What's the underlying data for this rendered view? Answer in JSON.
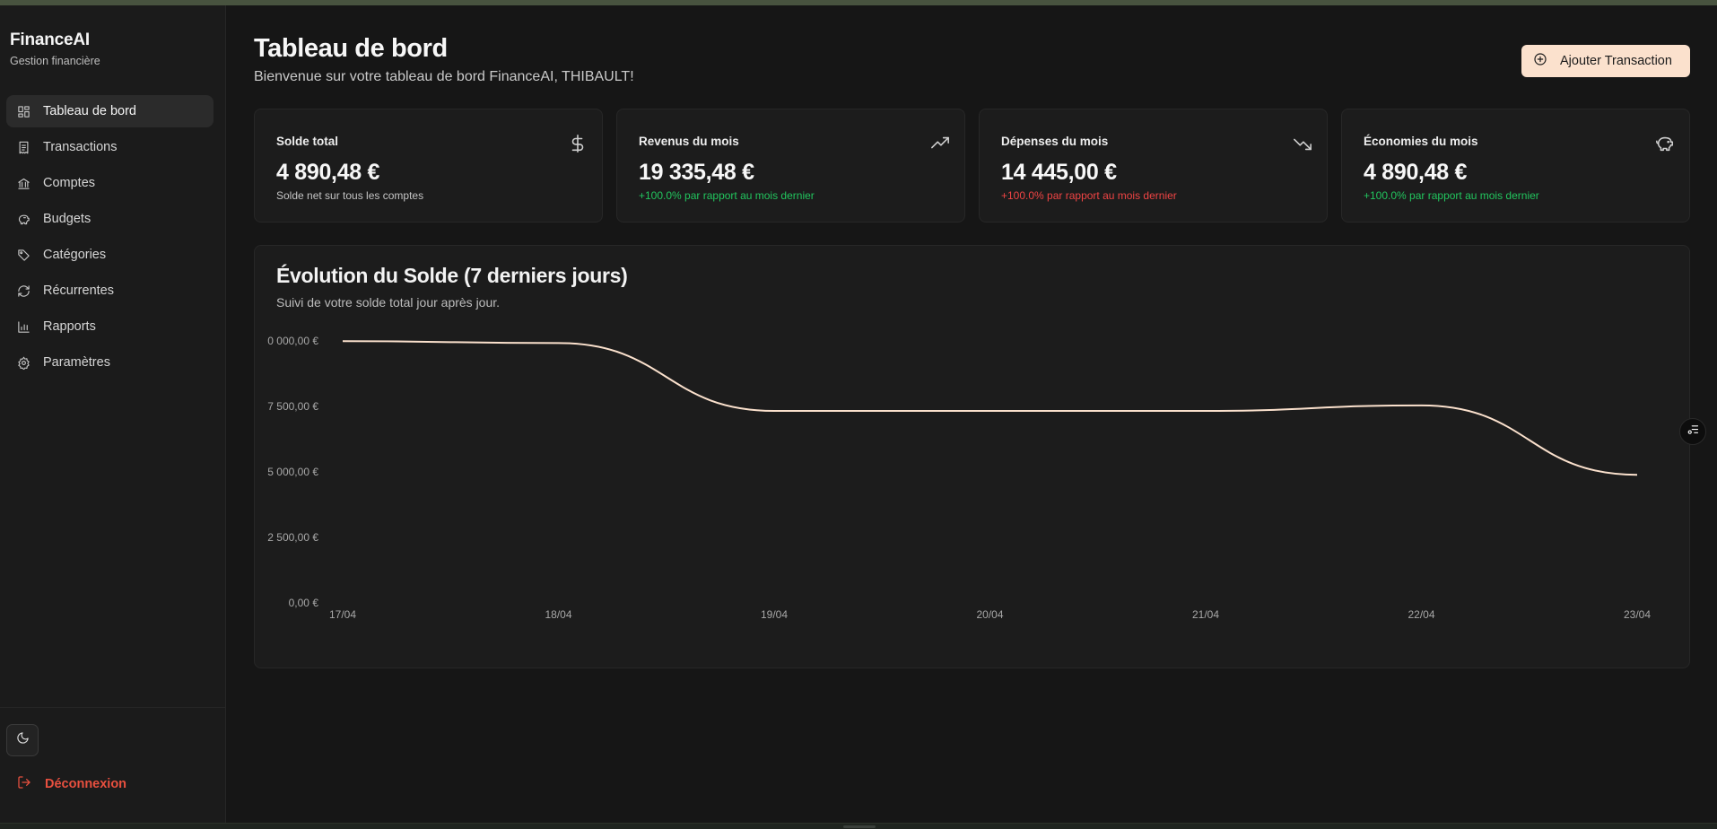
{
  "brand": {
    "title": "FinanceAI",
    "subtitle": "Gestion financière"
  },
  "sidebar": {
    "items": [
      {
        "label": "Tableau de bord",
        "icon": "dashboard-icon",
        "active": true
      },
      {
        "label": "Transactions",
        "icon": "receipt-icon",
        "active": false
      },
      {
        "label": "Comptes",
        "icon": "bank-icon",
        "active": false
      },
      {
        "label": "Budgets",
        "icon": "piggy-bank-icon",
        "active": false
      },
      {
        "label": "Catégories",
        "icon": "tag-icon",
        "active": false
      },
      {
        "label": "Récurrentes",
        "icon": "refresh-icon",
        "active": false
      },
      {
        "label": "Rapports",
        "icon": "bar-chart-icon",
        "active": false
      },
      {
        "label": "Paramètres",
        "icon": "gear-icon",
        "active": false
      }
    ],
    "theme_toggle_icon": "moon-icon",
    "logout_label": "Déconnexion"
  },
  "header": {
    "title": "Tableau de bord",
    "subtitle": "Bienvenue sur votre tableau de bord FinanceAI, THIBAULT!",
    "add_button_label": "Ajouter Transaction"
  },
  "cards": [
    {
      "title": "Solde total",
      "value": "4 890,48 €",
      "note": "Solde net sur tous les comptes",
      "note_type": "neutral",
      "icon": "dollar-icon"
    },
    {
      "title": "Revenus du mois",
      "value": "19 335,48 €",
      "note": "+100.0% par rapport au mois dernier",
      "note_type": "pos",
      "icon": "trending-up-icon"
    },
    {
      "title": "Dépenses du mois",
      "value": "14 445,00 €",
      "note": "+100.0% par rapport au mois dernier",
      "note_type": "neg",
      "icon": "trending-down-icon"
    },
    {
      "title": "Économies du mois",
      "value": "4 890,48 €",
      "note": "+100.0% par rapport au mois dernier",
      "note_type": "pos",
      "icon": "piggy-bank-icon"
    }
  ],
  "colors": {
    "accent": "#fbe1cd",
    "positive": "#22c55e",
    "negative": "#ef4444",
    "logout": "#e8503f",
    "line": "#fbe1cd"
  },
  "chart_data": {
    "type": "line",
    "title": "Évolution du Solde (7 derniers jours)",
    "subtitle": "Suivi de votre solde total jour après jour.",
    "categories": [
      "17/04",
      "18/04",
      "19/04",
      "20/04",
      "21/04",
      "22/04",
      "23/04"
    ],
    "series": [
      {
        "values": [
          9990,
          9920,
          7330,
          7330,
          7330,
          7540,
          4890.48
        ]
      }
    ],
    "yticks": [
      "0,00 €",
      "2 500,00 €",
      "5 000,00 €",
      "7 500,00 €",
      "0 000,00 €"
    ],
    "ylim": [
      0,
      10000
    ],
    "grid": false,
    "smooth": true
  }
}
